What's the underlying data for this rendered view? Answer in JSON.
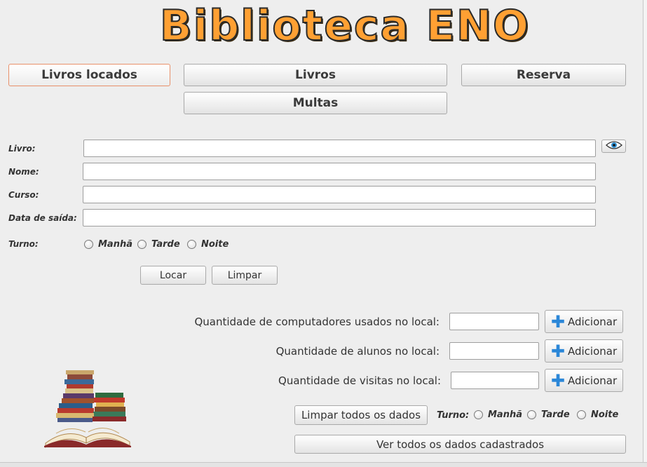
{
  "app": {
    "title": "Biblioteca ENO"
  },
  "nav": {
    "locados": "Livros locados",
    "livros": "Livros",
    "reserva": "Reserva",
    "multas": "Multas"
  },
  "form": {
    "livro_label": "Livro:",
    "nome_label": "Nome:",
    "curso_label": "Curso:",
    "data_label": "Data de saída:",
    "turno_label": "Turno:",
    "livro_value": "",
    "nome_value": "",
    "curso_value": "",
    "data_value": "",
    "turno_options": [
      "Manhã",
      "Tarde",
      "Noite"
    ],
    "locar_label": "Locar",
    "limpar_label": "Limpar"
  },
  "stats": {
    "computadores_label": "Quantidade de computadores usados no local:",
    "alunos_label": "Quantidade de alunos no local:",
    "visitas_label": "Quantidade de visitas no local:",
    "computadores_value": "",
    "alunos_value": "",
    "visitas_value": "",
    "adicionar_label": "Adicionar",
    "limpar_todos_label": "Limpar todos os dados",
    "turno_label": "Turno:",
    "turno_options": [
      "Manhã",
      "Tarde",
      "Noite"
    ],
    "ver_todos_label": "Ver todos os dados cadastrados"
  },
  "icons": {
    "view": "eye-icon",
    "add": "plus-icon",
    "books": "books-stack-icon"
  },
  "colors": {
    "title_fill": "#ffa033",
    "active_tab_border": "#e8906a",
    "plus_blue": "#2b87d8"
  }
}
